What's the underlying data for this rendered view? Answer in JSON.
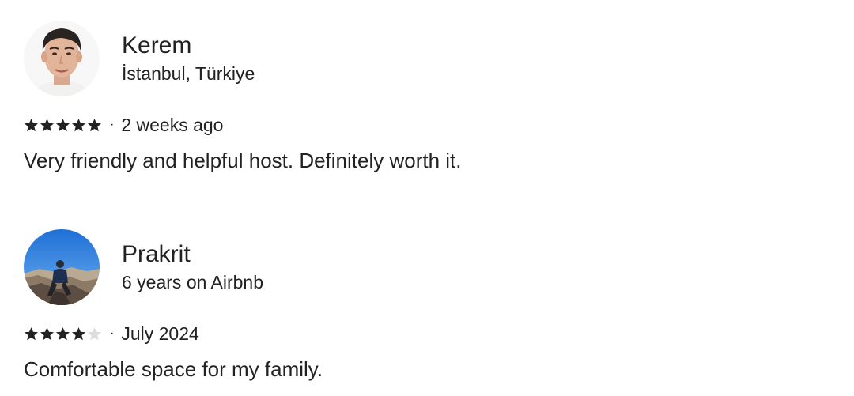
{
  "reviews": [
    {
      "name": "Kerem",
      "subtitle": "İstanbul, Türkiye",
      "rating": 5,
      "max_rating": 5,
      "date": "2 weeks ago",
      "separator": "·",
      "comment": "Very friendly and helpful host. Definitely worth it.",
      "avatar": "person-portrait-photo"
    },
    {
      "name": "Prakrit",
      "subtitle": "6 years on Airbnb",
      "rating": 4,
      "max_rating": 5,
      "date": "July 2024",
      "separator": "·",
      "comment": "Comfortable space for my family.",
      "avatar": "mountain-summit-photo"
    }
  ],
  "colors": {
    "text": "#222222",
    "star_filled": "#222222",
    "star_empty": "#dddddd"
  }
}
